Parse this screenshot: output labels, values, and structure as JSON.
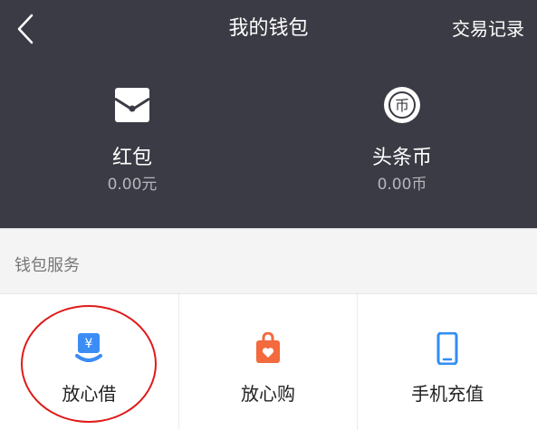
{
  "nav": {
    "title": "我的钱包",
    "records_label": "交易记录",
    "back_icon": "chevron-left-icon"
  },
  "assets": [
    {
      "icon": "red-packet-icon",
      "label": "红包",
      "value": "0.00元"
    },
    {
      "icon": "coin-icon",
      "label": "头条币",
      "value": "0.00币",
      "icon_glyph": "币"
    }
  ],
  "services_section": {
    "title": "钱包服务",
    "items": [
      {
        "icon": "loan-icon",
        "label": "放心借",
        "icon_glyph": "¥",
        "color": "#3b8cf5"
      },
      {
        "icon": "shopping-bag-icon",
        "label": "放心购",
        "color": "#f26a3d"
      },
      {
        "icon": "phone-icon",
        "label": "手机充值",
        "color": "#2f8ef5"
      }
    ]
  },
  "colors": {
    "header_bg": "#3b3b45",
    "highlight_circle": "#e01a1a"
  }
}
